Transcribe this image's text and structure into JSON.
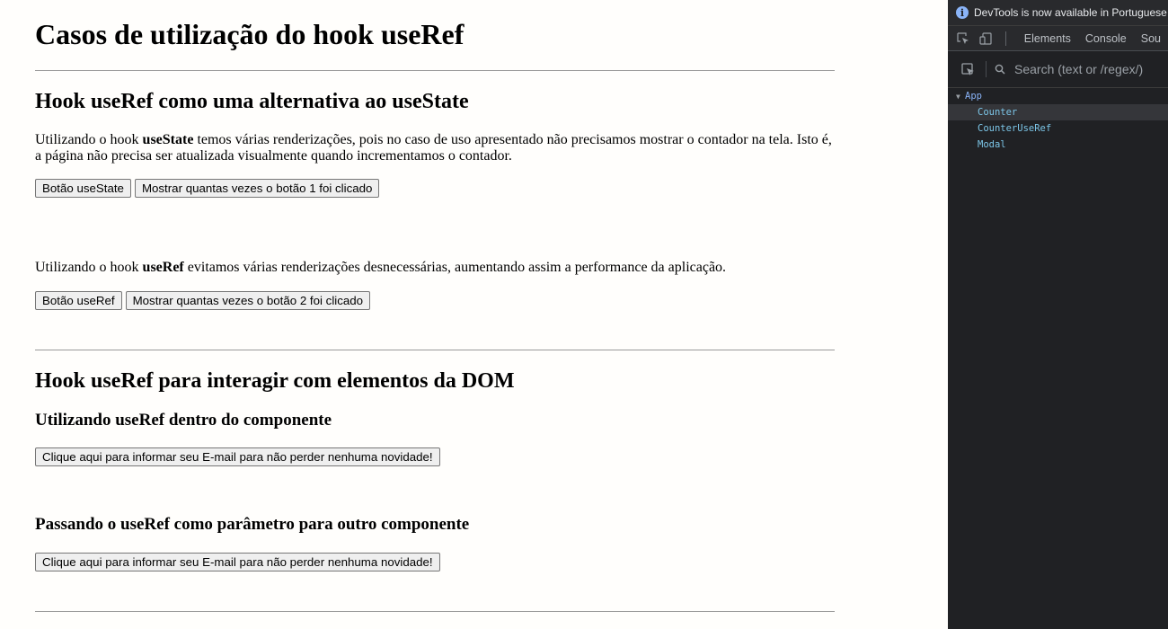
{
  "page": {
    "title": "Casos de utilização do hook useRef",
    "section1": {
      "heading": "Hook useRef como uma alternativa ao useState",
      "para1": {
        "before": "Utilizando o hook ",
        "bold": "useState",
        "after": " temos várias renderizações, pois no caso de uso apresentado não precisamos mostrar o contador na tela. Isto é, a página não precisa ser atualizada visualmente quando incrementamos o contador."
      },
      "buttons1": {
        "primary": "Botão useState",
        "secondary": "Mostrar quantas vezes o botão 1 foi clicado"
      },
      "para2": {
        "before": "Utilizando o hook ",
        "bold": "useRef",
        "after": " evitamos várias renderizações desnecessárias, aumentando assim a performance da aplicação."
      },
      "buttons2": {
        "primary": "Botão useRef",
        "secondary": "Mostrar quantas vezes o botão 2 foi clicado"
      }
    },
    "section2": {
      "heading": "Hook useRef para interagir com elementos da DOM",
      "sub1": {
        "heading": "Utilizando useRef dentro do componente",
        "button": "Clique aqui para informar seu E-mail para não perder nenhuma novidade!"
      },
      "sub2": {
        "heading": "Passando o useRef como parâmetro para outro componente",
        "button": "Clique aqui para informar seu E-mail para não perder nenhuma novidade!"
      }
    }
  },
  "devtools": {
    "info_text": "DevTools is now available in Portuguese",
    "info_icon": "info-icon",
    "tabs": [
      "Elements",
      "Console",
      "Sou"
    ],
    "search_placeholder": "Search (text or /regex/)",
    "tree": {
      "root": "App",
      "children": [
        "Counter",
        "CounterUseRef",
        "Modal"
      ],
      "selected": "Counter"
    },
    "colors": {
      "background": "#202124",
      "component_name": "#8ab4f8",
      "selected_row": "#35363a"
    }
  }
}
